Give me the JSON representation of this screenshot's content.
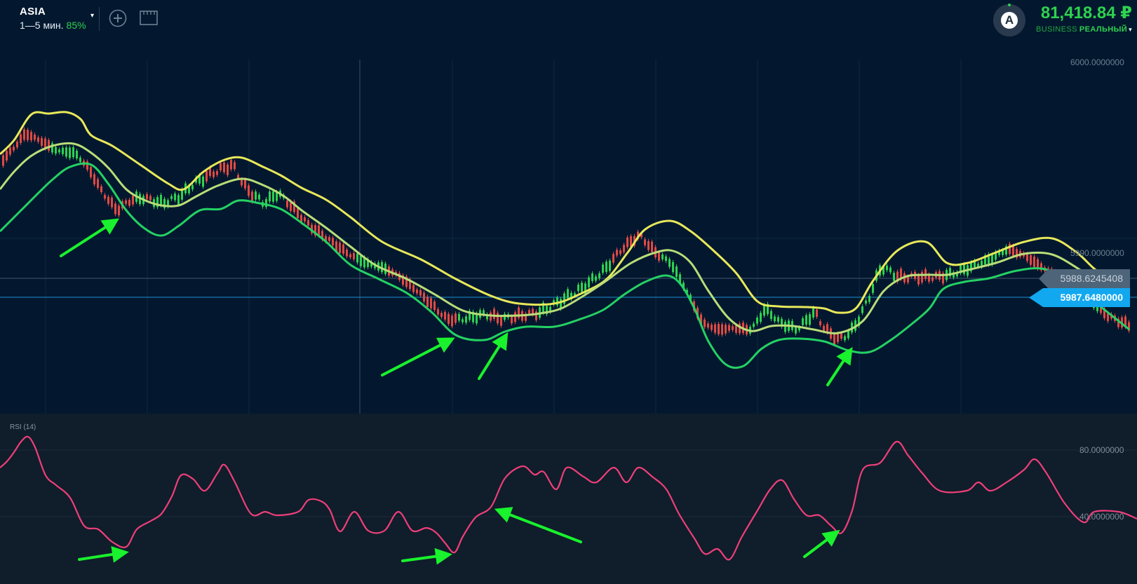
{
  "header": {
    "asset_name": "ASIA",
    "timeframe": "1—5 мин.",
    "payout": "85%",
    "caret": "▾",
    "add_icon": "plus-circle-icon",
    "ruler_icon": "ruler-icon"
  },
  "account": {
    "avatar_letter": "A",
    "balance": "81,418.84 ₽",
    "type": "BUSINESS",
    "mode": "РЕАЛЬНЫЙ",
    "caret": "▾"
  },
  "price_axis": {
    "top_label": "6000.0000000",
    "mid_label": "5990.0000000",
    "last_price": "5988.6245408",
    "current_price": "5987.6480000"
  },
  "rsi": {
    "label": "RSI (14)",
    "upper_label": "80.0000000",
    "lower_label": "40.0000000"
  },
  "colors": {
    "background": "#03182f",
    "rsi_background": "#101d2b",
    "candle_up": "#2fd14f",
    "candle_down": "#e04a44",
    "band_upper": "#e8e85a",
    "band_middle": "#b9dd78",
    "band_lower": "#25d163",
    "rsi_line": "#ee3f78",
    "arrow": "#19f22d",
    "current_price_tag": "#12a8f0"
  }
}
